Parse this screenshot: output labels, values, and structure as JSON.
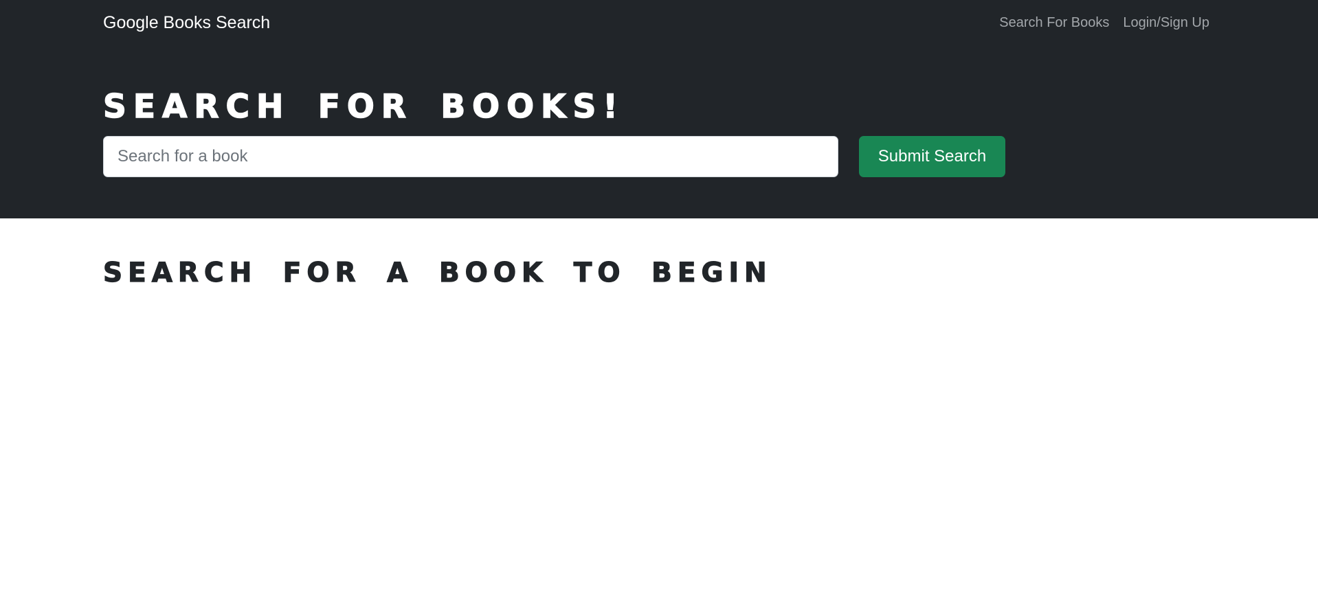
{
  "navbar": {
    "brand": "Google Books Search",
    "links": [
      {
        "label": "Search For Books"
      },
      {
        "label": "Login/Sign Up"
      }
    ]
  },
  "hero": {
    "title": "SEARCH FOR BOOKS!",
    "search": {
      "placeholder": "Search for a book",
      "value": ""
    },
    "submit_label": "Submit Search"
  },
  "results": {
    "heading": "SEARCH FOR A BOOK TO BEGIN"
  },
  "colors": {
    "header_bg": "#212529",
    "submit_green": "#198754",
    "nav_link": "#a3a7ab"
  }
}
